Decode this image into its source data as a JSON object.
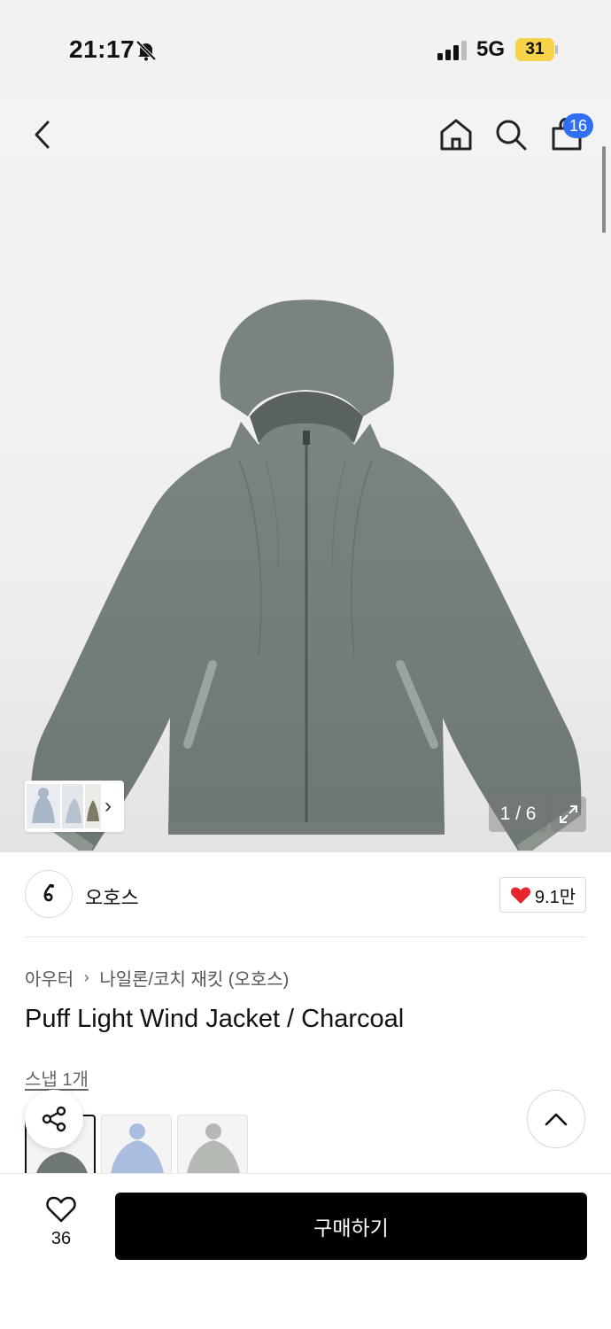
{
  "status_bar": {
    "time": "21:17",
    "network": "5G",
    "battery": "31"
  },
  "header": {
    "cart_count": "16"
  },
  "gallery": {
    "counter": "1 / 6"
  },
  "brand": {
    "name": "오호스",
    "likes": "9.1만"
  },
  "breadcrumb": {
    "category": "아우터",
    "subcategory": "나일론/코치 재킷 (오호스)"
  },
  "product": {
    "title": "Puff Light Wind Jacket / Charcoal",
    "snap_link": "스냅 1개"
  },
  "swatches": [
    {
      "color": "#6f7872"
    },
    {
      "color": "#a9bde0"
    },
    {
      "color": "#b4bab3"
    }
  ],
  "bottom_bar": {
    "wish_count": "36",
    "buy_label": "구매하기"
  },
  "colors": {
    "badge": "#2f6ff2",
    "heart": "#e8242c",
    "buy_button": "#000000",
    "battery": "#f7d34a"
  }
}
